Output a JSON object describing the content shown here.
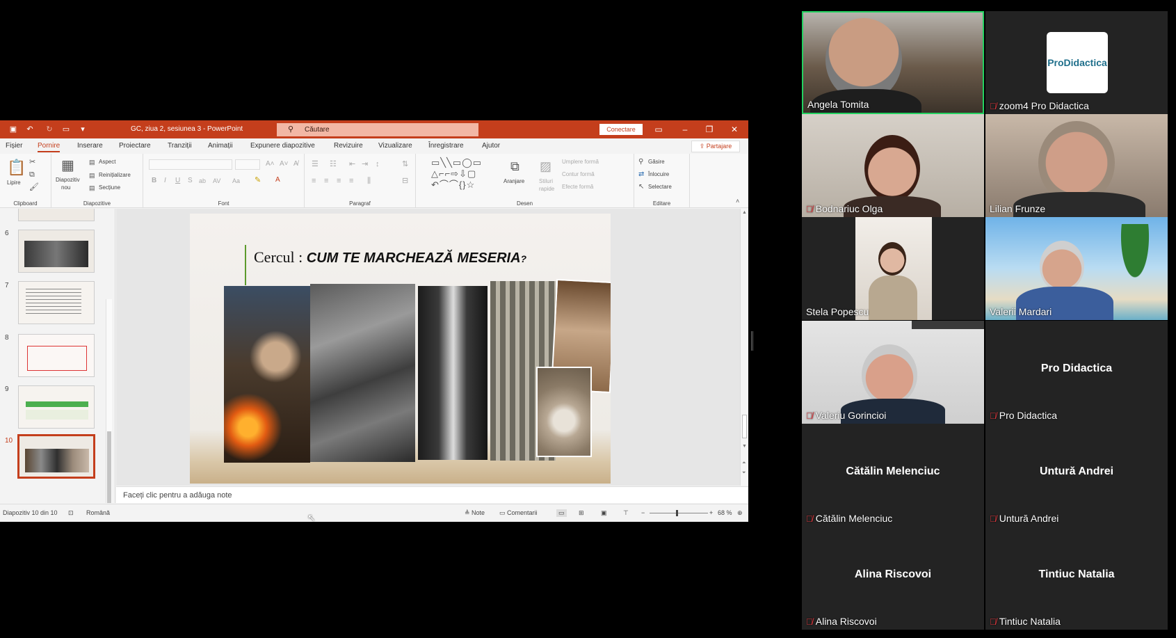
{
  "ppt": {
    "doc_title": "GC, ziua 2, sesiunea 3  -  PowerPoint",
    "search_label": "Căutare",
    "connect_label": "Conectare",
    "share_label": "Partajare",
    "menu": [
      "Fișier",
      "Pornire",
      "Inserare",
      "Proiectare",
      "Tranziții",
      "Animații",
      "Expunere diapozitive",
      "Revizuire",
      "Vizualizare",
      "Înregistrare",
      "Ajutor"
    ],
    "active_menu": "Pornire",
    "ribbon": {
      "clipboard": {
        "paste": "Lipire",
        "group": "Clipboard"
      },
      "slides": {
        "new_slide_1": "Diapozitiv",
        "new_slide_2": "nou",
        "layout": "Aspect",
        "reset": "Reinițializare",
        "section": "Secțiune",
        "group": "Diapozitive"
      },
      "font": {
        "group": "Font"
      },
      "paragraph": {
        "group": "Paragraf"
      },
      "drawing": {
        "arrange": "Aranjare",
        "styles_1": "Stiluri",
        "styles_2": "rapide",
        "fill": "Umplere formă",
        "outline": "Contur formă",
        "effects": "Efecte formă",
        "group": "Desen"
      },
      "editing": {
        "find": "Găsire",
        "replace": "Înlocuire",
        "select": "Selectare",
        "group": "Editare"
      }
    },
    "slide_numbers": [
      "6",
      "7",
      "8",
      "9",
      "10"
    ],
    "selected_slide": "10",
    "slide": {
      "title_prefix": "Cercul : ",
      "title_emphasis": "CUM TE MARCHEAZĂ MESERIA",
      "title_suffix": "?"
    },
    "notes_placeholder": "Faceți clic pentru a adăuga note",
    "status": {
      "slide_counter": "Diapozitiv 10 din 10",
      "language": "Română",
      "notes": "Note",
      "comments": "Comentarii",
      "zoom": "68 %"
    }
  },
  "participants": [
    {
      "name": "Angela Tomita",
      "muted": false,
      "video": true,
      "active": true
    },
    {
      "name": "zoom4 Pro Didactica",
      "muted": true,
      "video": true,
      "logo_text": "ProDidactica"
    },
    {
      "name": "Bodnariuc Olga",
      "muted": true,
      "video": true
    },
    {
      "name": "Lilian Frunze",
      "muted": false,
      "video": true
    },
    {
      "name": "Stela Popescu",
      "muted": false,
      "video": true
    },
    {
      "name": "Valerii Mardari",
      "muted": false,
      "video": true
    },
    {
      "name": "Valeriu Gorincioi",
      "muted": true,
      "video": true
    },
    {
      "name": "Pro Didactica",
      "muted": true,
      "video": false
    },
    {
      "name": "Cătălin Melenciuc",
      "muted": true,
      "video": false
    },
    {
      "name": "Untură Andrei",
      "muted": true,
      "video": false
    },
    {
      "name": "Alina Riscovoi",
      "muted": true,
      "video": false
    },
    {
      "name": "Tintiuc Natalia",
      "muted": true,
      "video": false
    }
  ],
  "colors": {
    "ppt_accent": "#c43e1c",
    "active_speaker": "#23d160",
    "muted_icon": "#e0383e"
  }
}
